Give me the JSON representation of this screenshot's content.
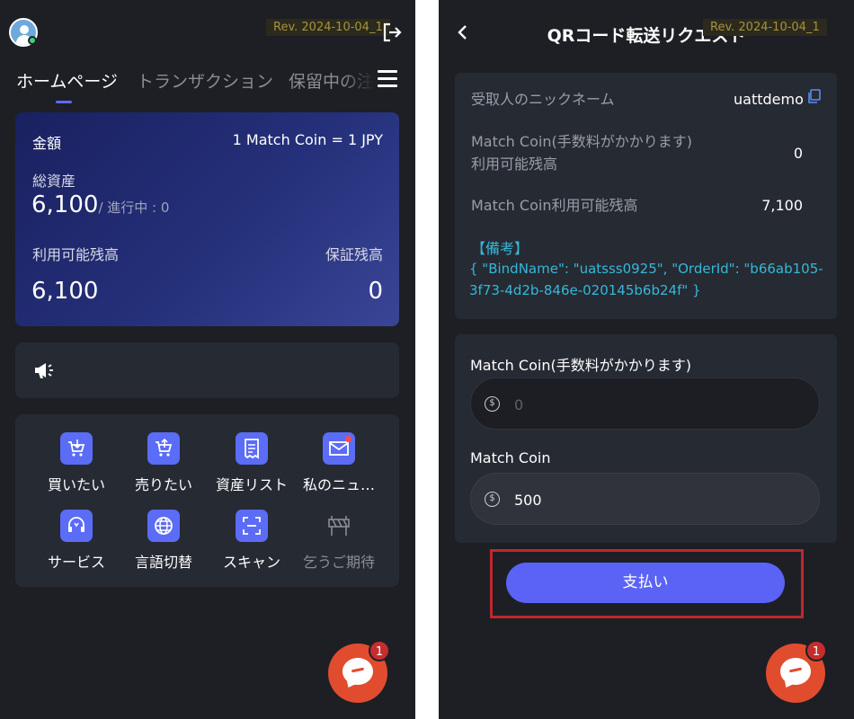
{
  "revision": "Rev. 2024-10-04_1",
  "home": {
    "tabs": [
      "ホームページ",
      "トランザクション",
      "保留中の注"
    ],
    "balance_card": {
      "amount_label": "金額",
      "rate": "1 Match Coin = 1 JPY",
      "total_assets_label": "総資産",
      "total_assets_value": "6,100",
      "in_progress": "/ 進行中 : 0",
      "available_label": "利用可能残高",
      "deposit_label": "保証残高",
      "available_value": "6,100",
      "deposit_value": "0"
    },
    "grid": [
      {
        "label": "買いたい",
        "icon": "cart-down-icon"
      },
      {
        "label": "売りたい",
        "icon": "cart-up-icon"
      },
      {
        "label": "資産リスト",
        "icon": "receipt-icon"
      },
      {
        "label": "私のニュ…",
        "icon": "mail-icon"
      },
      {
        "label": "サービス",
        "icon": "headset-icon"
      },
      {
        "label": "言語切替",
        "icon": "globe-icon"
      },
      {
        "label": "スキャン",
        "icon": "scan-icon"
      },
      {
        "label": "乞うご期待",
        "icon": "barrier-icon"
      }
    ],
    "chat_badge": "1"
  },
  "transfer": {
    "title": "QRコード転送リクエスト",
    "recipient_label": "受取人のニックネーム",
    "recipient_value": "uattdemo",
    "fee_balance_label": "Match Coin(手数料がかかります)利用可能残高",
    "fee_balance_value": "0",
    "balance_label": "Match Coin利用可能残高",
    "balance_value": "7,100",
    "remark_title": "【備考】",
    "remark_body": "{ \"BindName\": \"uatsss0925\", \"OrderId\": \"b66ab105-3f73-4d2b-846e-020145b6b24f\" }",
    "fee_coin_label": "Match Coin(手数料がかかります)",
    "fee_coin_placeholder": "0",
    "coin_label": "Match Coin",
    "coin_value": "500",
    "pay_button": "支払い",
    "chat_badge": "1"
  },
  "colors": {
    "accent": "#5b63f6",
    "remark": "#35b8d9",
    "highlight": "#c0272d",
    "chat": "#e14c2f"
  }
}
